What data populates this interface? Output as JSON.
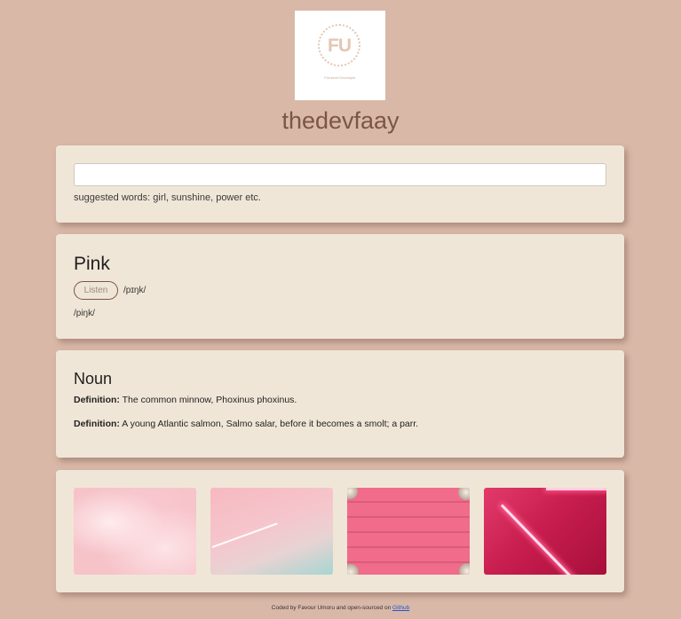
{
  "logo": {
    "mark": "FU",
    "subtitle": "Frontend Developer"
  },
  "brand": {
    "title": "thedevfaay"
  },
  "search": {
    "value": "",
    "placeholder": "",
    "suggestion_text": "suggested words: girl, sunshine, power etc."
  },
  "word": {
    "title": "Pink",
    "listen_label": "Listen",
    "phonetic_inline": "/pɪŋk/",
    "phonetic_line": "/piŋk/"
  },
  "meaning": {
    "part_of_speech": "Noun",
    "definitions": [
      {
        "label": "Definition:",
        "text": "The common minnow, Phoxinus phoxinus."
      },
      {
        "label": "Definition:",
        "text": "A young Atlantic salmon, Salmo salar, before it becomes a smolt; a parr."
      }
    ]
  },
  "images": {
    "count": 4,
    "colors": [
      "#f6c3c9",
      "#f5c6cc",
      "#f06c8a",
      "#c81e4f"
    ]
  },
  "footer": {
    "prefix": "Coded by Favour Umoru and open-sourced on",
    "link_label": "Github"
  },
  "colors": {
    "background": "#d9b8a8",
    "card": "#f0e6d7",
    "brand_text": "#7a5646"
  }
}
